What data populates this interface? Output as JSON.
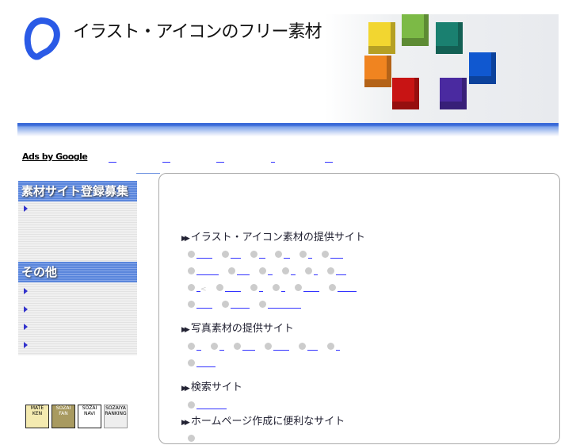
{
  "header": {
    "site_title": "イラスト・アイコンのフリー素材",
    "ads_label": "Ads by Google"
  },
  "sidebar": {
    "sections": [
      {
        "title": "素材サイト登録募集",
        "items": 1
      },
      {
        "title": "その他",
        "items": 4
      }
    ]
  },
  "main": {
    "sections": [
      {
        "title": "イラスト・アイコン素材の提供サイト"
      },
      {
        "title": "写真素材の提供サイト"
      },
      {
        "title": "検索サイト"
      },
      {
        "title": "ホームページ作成に便利なサイト"
      }
    ],
    "stray_char": "<"
  },
  "banners": [
    {
      "label": "MATE KEN"
    },
    {
      "label": "SOZAI FAN"
    },
    {
      "label": "SOZAI NAVI"
    },
    {
      "label": "SOZAIYA RANKING"
    }
  ],
  "colors": {
    "accent": "#3a6ad8",
    "link": "#3333ff",
    "sidebar_header": "#5a86dc"
  }
}
